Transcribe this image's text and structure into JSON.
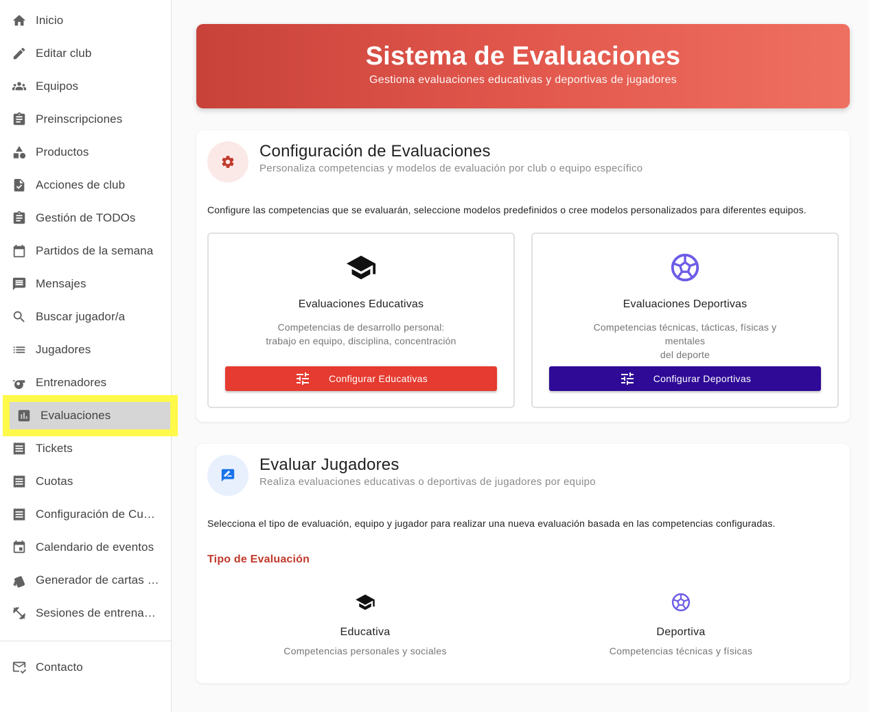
{
  "sidebar": {
    "items": [
      {
        "label": "Inicio",
        "icon": "home-icon"
      },
      {
        "label": "Editar club",
        "icon": "pencil-icon"
      },
      {
        "label": "Equipos",
        "icon": "groups-icon"
      },
      {
        "label": "Preinscripciones",
        "icon": "clipboard-icon"
      },
      {
        "label": "Productos",
        "icon": "shapes-icon"
      },
      {
        "label": "Acciones de club",
        "icon": "file-check-icon"
      },
      {
        "label": "Gestión de TODOs",
        "icon": "clipboard-icon"
      },
      {
        "label": "Partidos de la semana",
        "icon": "calendar-icon"
      },
      {
        "label": "Mensajes",
        "icon": "message-icon"
      },
      {
        "label": "Buscar jugador/a",
        "icon": "search-icon"
      },
      {
        "label": "Jugadores",
        "icon": "list-icon"
      },
      {
        "label": "Entrenadores",
        "icon": "whistle-icon"
      },
      {
        "label": "Evaluaciones",
        "icon": "bar-chart-icon"
      },
      {
        "label": "Tickets",
        "icon": "receipt-icon"
      },
      {
        "label": "Cuotas",
        "icon": "receipt-icon"
      },
      {
        "label": "Configuración de Cuotas",
        "icon": "receipt-icon"
      },
      {
        "label": "Calendario de eventos",
        "icon": "event-icon"
      },
      {
        "label": "Generador de cartas de jugadores",
        "icon": "cards-icon"
      },
      {
        "label": "Sesiones de entrenamiento",
        "icon": "dumbbell-icon"
      }
    ],
    "contact": {
      "label": "Contacto",
      "icon": "mail-check-icon"
    }
  },
  "hero": {
    "title": "Sistema de Evaluaciones",
    "subtitle": "Gestiona evaluaciones educativas y deportivas de jugadores"
  },
  "config": {
    "title": "Configuración de Evaluaciones",
    "subtitle": "Personaliza competencias y modelos de evaluación por club o equipo específico",
    "description": "Configure las competencias que se evaluarán, seleccione modelos predefinidos o cree modelos personalizados para diferentes equipos.",
    "educativas": {
      "title": "Evaluaciones Educativas",
      "desc_line1": "Competencias de desarrollo personal:",
      "desc_line2": "trabajo en equipo, disciplina, concentración",
      "button": "Configurar Educativas"
    },
    "deportivas": {
      "title": "Evaluaciones Deportivas",
      "desc_line1": "Competencias técnicas, tácticas, físicas y mentales",
      "desc_line2": "del deporte",
      "button": "Configurar Deportivas"
    }
  },
  "evaluar": {
    "title": "Evaluar Jugadores",
    "subtitle": "Realiza evaluaciones educativas o deportivas de jugadores por equipo",
    "description": "Selecciona el tipo de evaluación, equipo y jugador para realizar una nueva evaluación basada en las competencias configuradas.",
    "section_label": "Tipo de Evaluación",
    "types": [
      {
        "title": "Educativa",
        "desc": "Competencias personales y sociales"
      },
      {
        "title": "Deportiva",
        "desc": "Competencias técnicas y físicas"
      }
    ]
  },
  "colors": {
    "hero_start": "#c8423a",
    "hero_end": "#ee7060",
    "btn_educativas": "#e53b30",
    "btn_deportivas": "#2e0a96",
    "accent_red": "#c0392b",
    "accent_purple": "#6c5ce7",
    "highlight": "#fff94a"
  }
}
